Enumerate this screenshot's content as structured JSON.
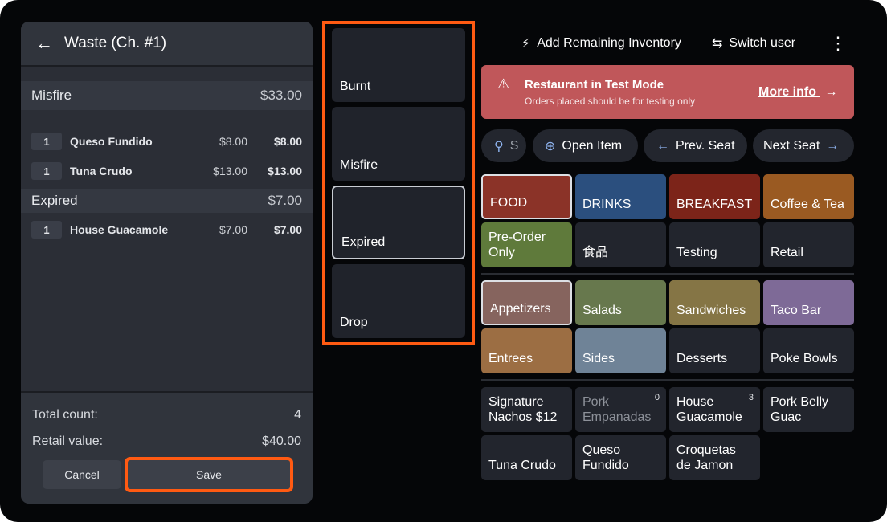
{
  "waste": {
    "title": "Waste (Ch. #1)",
    "categories": [
      {
        "name": "Misfire",
        "amount": "$33.00"
      },
      {
        "name": "Expired",
        "amount": "$7.00"
      }
    ],
    "items": [
      {
        "qty": "1",
        "name": "Queso Fundido",
        "price": "$8.00",
        "total": "$8.00"
      },
      {
        "qty": "1",
        "name": "Tuna Crudo",
        "price": "$13.00",
        "total": "$13.00"
      },
      {
        "qty": "1",
        "name": "House Guacamole",
        "price": "$7.00",
        "total": "$7.00"
      }
    ],
    "total_count_label": "Total count:",
    "total_count": "4",
    "retail_value_label": "Retail value:",
    "retail_value": "$40.00",
    "cancel_label": "Cancel",
    "save_label": "Save"
  },
  "reasons": [
    "Burnt",
    "Misfire",
    "Expired",
    "Drop"
  ],
  "topbar": {
    "add_inventory": "Add Remaining Inventory",
    "switch_user": "Switch user"
  },
  "banner": {
    "title": "Restaurant in Test Mode",
    "subtitle": "Orders placed should be for testing only",
    "link": "More info"
  },
  "pills": {
    "search_letter": "S",
    "open_item": "Open Item",
    "prev_seat": "Prev. Seat",
    "next_seat": "Next Seat"
  },
  "menu_groups": [
    {
      "label": "FOOD",
      "color": "#8b3328"
    },
    {
      "label": "DRINKS",
      "color": "#2b4f7e"
    },
    {
      "label": "BREAKFAST",
      "color": "#7c2419"
    },
    {
      "label": "Coffee & Tea",
      "color": "#9a5a22"
    },
    {
      "label": "Pre-Order Only",
      "color": "#5f7a3b"
    },
    {
      "label": "食品",
      "color": "#22252d"
    },
    {
      "label": "Testing",
      "color": "#22252d"
    },
    {
      "label": "Retail",
      "color": "#22252d"
    }
  ],
  "categories": [
    {
      "label": "Appetizers",
      "color": "#86645e"
    },
    {
      "label": "Salads",
      "color": "#67784d"
    },
    {
      "label": "Sandwiches",
      "color": "#857545"
    },
    {
      "label": "Taco Bar",
      "color": "#7e6a97"
    },
    {
      "label": "Entrees",
      "color": "#9c6e43"
    },
    {
      "label": "Sides",
      "color": "#6f8397"
    },
    {
      "label": "Desserts",
      "color": "#22252d"
    },
    {
      "label": "Poke Bowls",
      "color": "#22252d"
    }
  ],
  "products": [
    {
      "label": "Signature Nachos $12",
      "badge": ""
    },
    {
      "label": "Pork Empanadas",
      "badge": "0"
    },
    {
      "label": "House Guacamole",
      "badge": "3"
    },
    {
      "label": "Pork Belly Guac",
      "badge": ""
    },
    {
      "label": "Tuna Crudo",
      "badge": ""
    },
    {
      "label": "Queso Fundido",
      "badge": ""
    },
    {
      "label": "Croquetas de Jamon",
      "badge": ""
    }
  ]
}
